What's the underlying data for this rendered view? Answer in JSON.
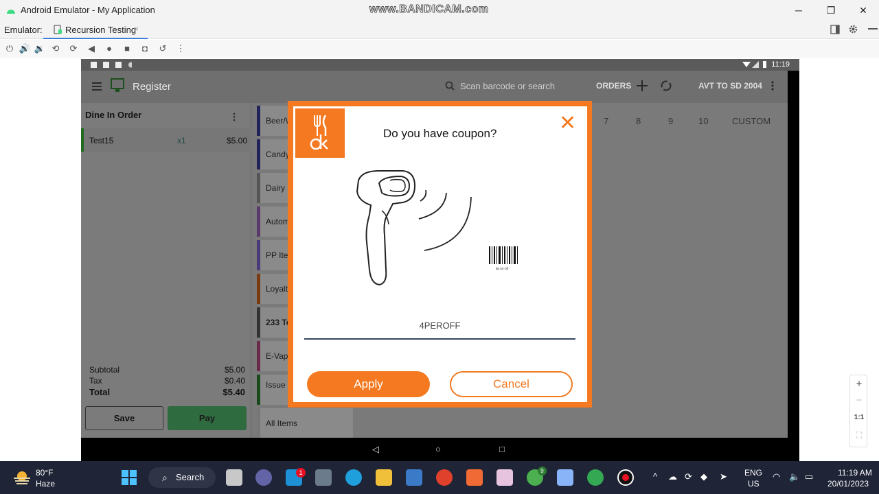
{
  "window": {
    "title": "Android Emulator - My Application",
    "watermark": "www.BANDICAM.com",
    "minimize": "─",
    "restore": "❐",
    "close": "✕"
  },
  "emulator_bar": {
    "label": "Emulator:",
    "tab_label": "Recursion Testing",
    "tab_close": "×"
  },
  "device_status": {
    "time": "11:19"
  },
  "app": {
    "title": "Register",
    "search_placeholder": "Scan barcode or search",
    "orders_label": "ORDERS",
    "store_label": "AVT TO SD 2004",
    "order_header": "Dine In Order",
    "order_item": {
      "name": "Test15",
      "qty": "x1",
      "price": "$5.00"
    },
    "subtotal_label": "Subtotal",
    "subtotal_value": "$5.00",
    "tax_label": "Tax",
    "tax_value": "$0.40",
    "total_label": "Total",
    "total_value": "$5.40",
    "save_label": "Save",
    "pay_label": "Pay",
    "categories": [
      "Beer/W",
      "Candy",
      "Dairy",
      "Autom",
      "PP Item",
      "Loyalt",
      "233 Te",
      "E-Vapo",
      "Issue - Jan, 20",
      "All Items"
    ],
    "number_keys": [
      "7",
      "8",
      "9",
      "10",
      "CUSTOM"
    ]
  },
  "dialog": {
    "question": "Do you have coupon?",
    "coupon_value": "4PEROFF",
    "apply_label": "Apply",
    "cancel_label": "Cancel",
    "barcode_caption": "$0.50 Off"
  },
  "taskbar": {
    "weather_temp": "80°F",
    "weather_desc": "Haze",
    "search_label": "Search",
    "lang_line1": "ENG",
    "lang_line2": "US",
    "clock_time": "11:19 AM",
    "clock_date": "20/01/2023",
    "notification_badge": "1",
    "chrome_badge": "9"
  }
}
